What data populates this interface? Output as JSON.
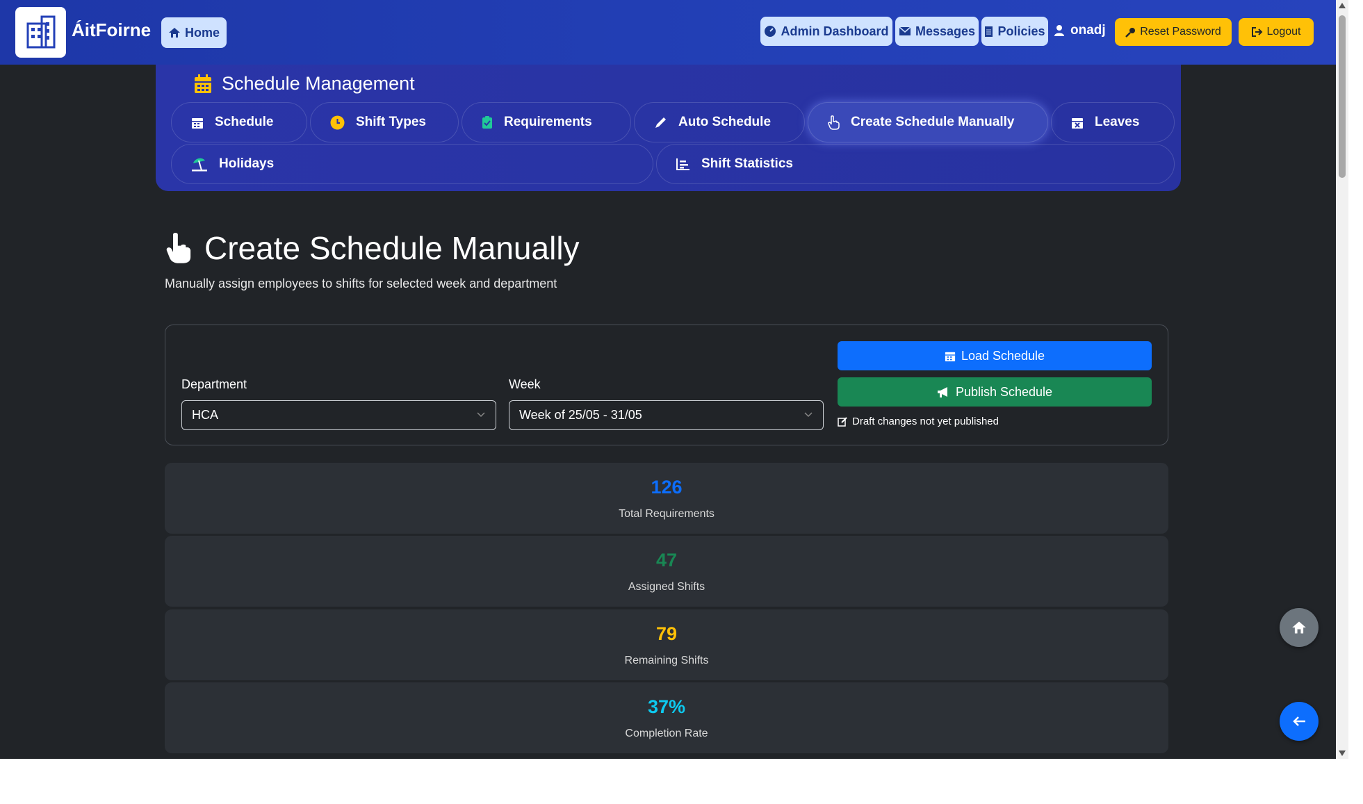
{
  "navbar": {
    "brand": "ÁitFoirne",
    "home_label": "Home",
    "admin_dashboard_label": "Admin Dashboard",
    "messages_label": "Messages",
    "policies_label": "Policies",
    "username": "onadj",
    "reset_password_label": "Reset Password",
    "logout_label": "Logout"
  },
  "schedule_management": {
    "title": "Schedule Management",
    "tabs": [
      {
        "label": "Schedule",
        "icon": "calendar-icon"
      },
      {
        "label": "Shift Types",
        "icon": "clock-icon"
      },
      {
        "label": "Requirements",
        "icon": "clipboard-icon"
      },
      {
        "label": "Auto Schedule",
        "icon": "pen-icon"
      },
      {
        "label": "Create Schedule Manually",
        "icon": "hand-pointer-icon"
      },
      {
        "label": "Leaves",
        "icon": "calendar-x-icon"
      },
      {
        "label": "Holidays",
        "icon": "umbrella-beach-icon"
      },
      {
        "label": "Shift Statistics",
        "icon": "chart-bar-icon"
      }
    ],
    "active_tab": "Create Schedule Manually"
  },
  "page": {
    "title": "Create Schedule Manually",
    "subtitle": "Manually assign employees to shifts for selected week and department"
  },
  "filters": {
    "department_label": "Department",
    "department_value": "HCA",
    "week_label": "Week",
    "week_value": "Week of 25/05 - 31/05",
    "load_label": "Load Schedule",
    "publish_label": "Publish Schedule",
    "draft_note": "Draft changes not yet published"
  },
  "stats": [
    {
      "value": "126",
      "label": "Total Requirements",
      "color": "#0d6efd"
    },
    {
      "value": "47",
      "label": "Assigned Shifts",
      "color": "#198754"
    },
    {
      "value": "79",
      "label": "Remaining Shifts",
      "color": "#ffc107"
    },
    {
      "value": "37%",
      "label": "Completion Rate",
      "color": "#0dcaf0"
    }
  ],
  "colors": {
    "navbar": "#2340b7",
    "panel": "#2a35a8",
    "background": "#212428",
    "accent_yellow": "#ffc107"
  }
}
